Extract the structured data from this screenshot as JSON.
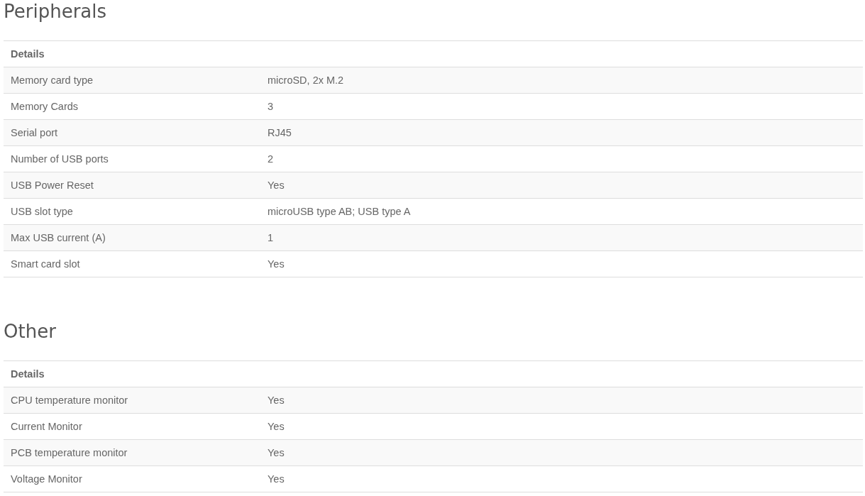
{
  "sections": [
    {
      "title": "Peripherals",
      "header": "Details",
      "rows": [
        {
          "label": "Memory card type",
          "value": "microSD, 2x M.2"
        },
        {
          "label": "Memory Cards",
          "value": "3"
        },
        {
          "label": "Serial port",
          "value": "RJ45"
        },
        {
          "label": "Number of USB ports",
          "value": "2"
        },
        {
          "label": "USB Power Reset",
          "value": "Yes"
        },
        {
          "label": "USB slot type",
          "value": "microUSB type AB; USB type A"
        },
        {
          "label": "Max USB current (A)",
          "value": "1"
        },
        {
          "label": "Smart card slot",
          "value": "Yes"
        }
      ]
    },
    {
      "title": "Other",
      "header": "Details",
      "rows": [
        {
          "label": "CPU temperature monitor",
          "value": "Yes"
        },
        {
          "label": "Current Monitor",
          "value": "Yes"
        },
        {
          "label": "PCB temperature monitor",
          "value": "Yes"
        },
        {
          "label": "Voltage Monitor",
          "value": "Yes"
        }
      ]
    }
  ]
}
